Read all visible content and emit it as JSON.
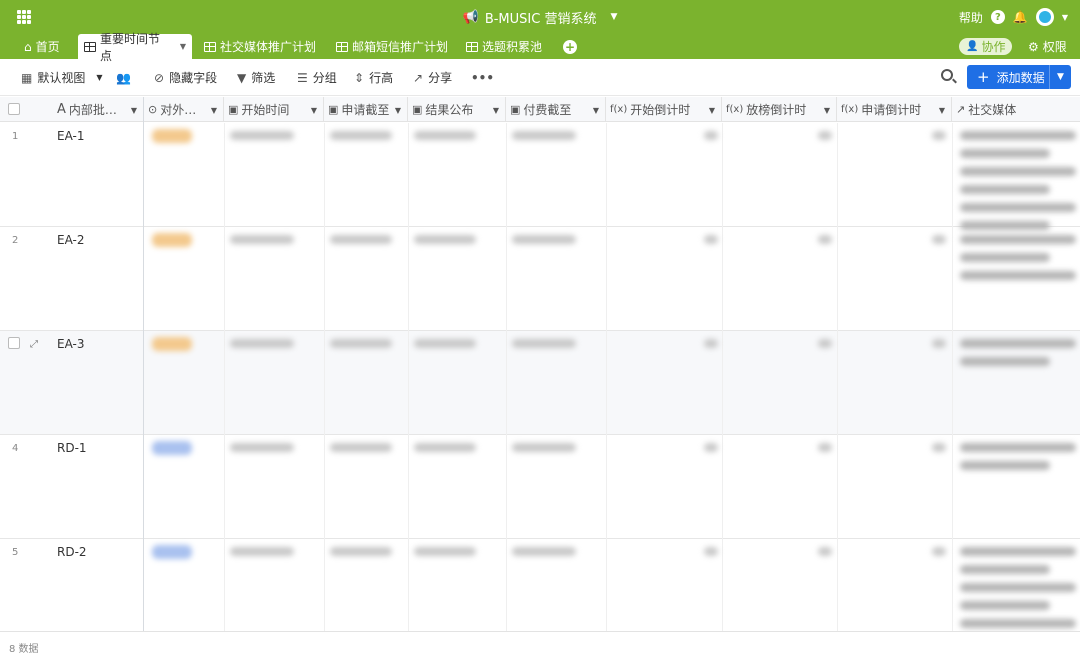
{
  "app": {
    "title": "B-MUSIC 营销系统",
    "help_label": "帮助"
  },
  "tabs": [
    {
      "label": "首页"
    },
    {
      "label": "重要时间节点"
    },
    {
      "label": "社交媒体推广计划"
    },
    {
      "label": "邮箱短信推广计划"
    },
    {
      "label": "选题积累池"
    }
  ],
  "collab_label": "协作",
  "permission_label": "权限",
  "toolbar": {
    "view_label": "默认视图",
    "hide_fields_label": "隐藏字段",
    "filter_label": "筛选",
    "group_label": "分组",
    "row_height_label": "行高",
    "share_label": "分享",
    "more_label": "•••",
    "add_data_label": "添加数据"
  },
  "columns": [
    {
      "label": "内部批…",
      "type_icon": "A"
    },
    {
      "label": "对外…",
      "type_icon": "⊙"
    },
    {
      "label": "开始时间",
      "type_icon": "📅"
    },
    {
      "label": "申请截至",
      "type_icon": "📅"
    },
    {
      "label": "结果公布",
      "type_icon": "📅"
    },
    {
      "label": "付费截至",
      "type_icon": "📅"
    },
    {
      "label": "开始倒计时",
      "type_icon": "f(x)"
    },
    {
      "label": "放榜倒计时",
      "type_icon": "f(x)"
    },
    {
      "label": "申请倒计时",
      "type_icon": "f(x)"
    },
    {
      "label": "社交媒体",
      "type_icon": "↗"
    }
  ],
  "rows": [
    {
      "num": "1",
      "name": "EA-1"
    },
    {
      "num": "2",
      "name": "EA-2"
    },
    {
      "num": "",
      "name": "EA-3"
    },
    {
      "num": "4",
      "name": "RD-1"
    },
    {
      "num": "5",
      "name": "RD-2"
    }
  ],
  "footer": {
    "count_label": "8 数据"
  },
  "colors": {
    "brand": "#7bb32e",
    "primary_button": "#1f6fe5",
    "tag_orange": "#f3c98d",
    "tag_blue": "#a9c1ef"
  }
}
